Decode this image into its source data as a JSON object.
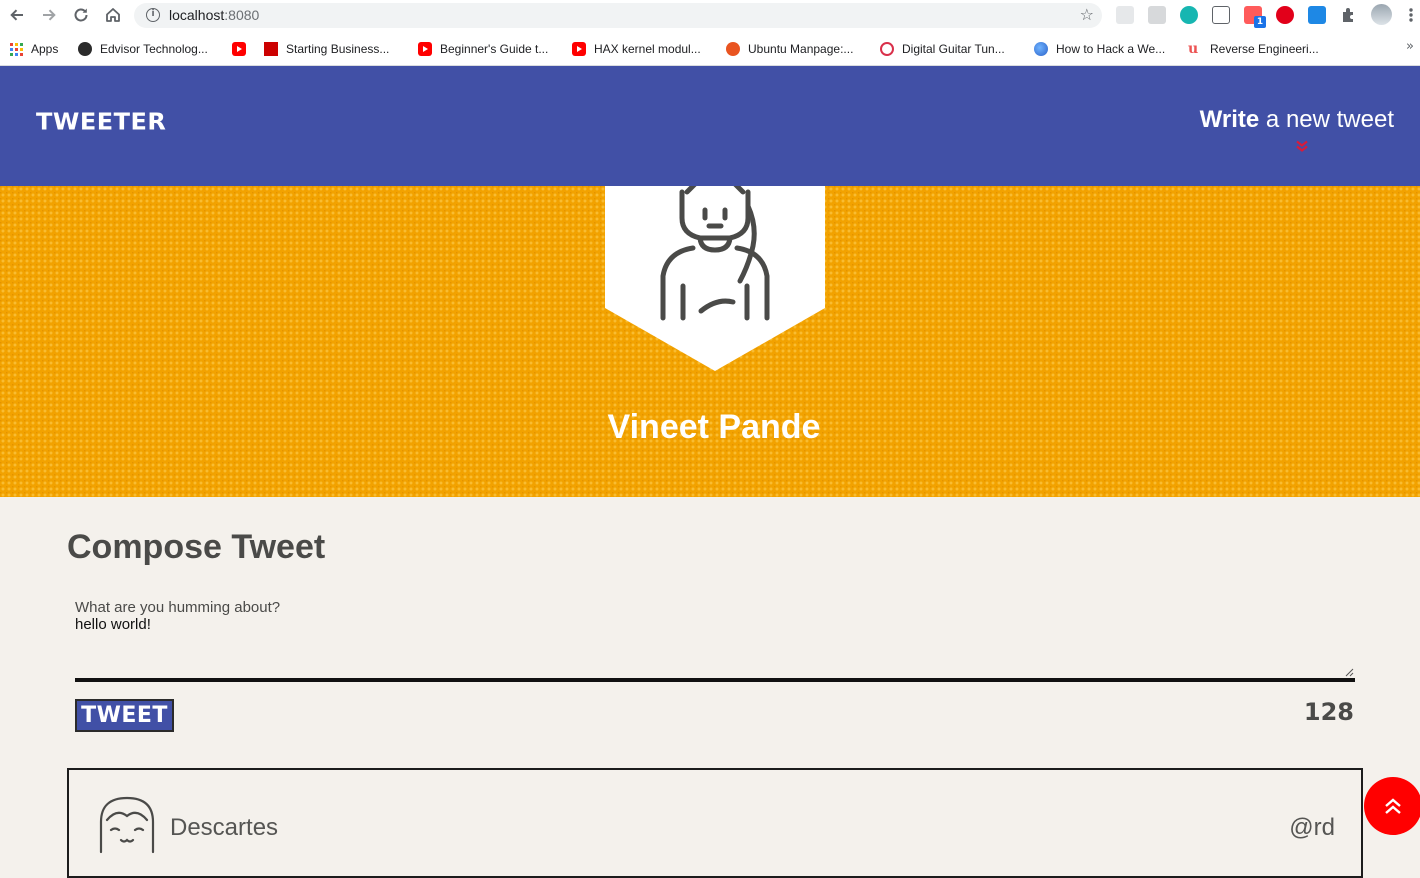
{
  "browser": {
    "url_host": "localhost",
    "url_port": ":8080",
    "bookmarks": [
      {
        "label": "Apps",
        "icon": "apps-grid-icon"
      },
      {
        "label": "Edvisor Technolog...",
        "icon": "github-icon"
      },
      {
        "label": "",
        "icon": "youtube-icon"
      },
      {
        "label": "Starting Business...",
        "icon": "ti-icon"
      },
      {
        "label": "Beginner's Guide t...",
        "icon": "youtube-icon"
      },
      {
        "label": "HAX kernel modul...",
        "icon": "youtube-icon"
      },
      {
        "label": "Ubuntu Manpage:...",
        "icon": "ubuntu-icon"
      },
      {
        "label": "Digital Guitar Tun...",
        "icon": "tuner-icon"
      },
      {
        "label": "How to Hack a We...",
        "icon": "globe-icon"
      },
      {
        "label": "Reverse Engineeri...",
        "icon": "udemy-icon"
      }
    ],
    "more_bookmarks": "»",
    "extension_badge": "1"
  },
  "header": {
    "brand": "TWEETER",
    "write_bold": "Write",
    "write_rest": "a new tweet"
  },
  "profile": {
    "name": "Vineet Pande"
  },
  "compose": {
    "title": "Compose Tweet",
    "label": "What are you humming about?",
    "value": "hello world!",
    "button": "TWEET",
    "counter": "128"
  },
  "tweets": [
    {
      "name": "Descartes",
      "handle": "@rd"
    }
  ],
  "colors": {
    "header_bg": "#4150a6",
    "band_bg": "#f2a200",
    "page_bg": "#f4f1ec",
    "accent_red": "#ff0000"
  }
}
